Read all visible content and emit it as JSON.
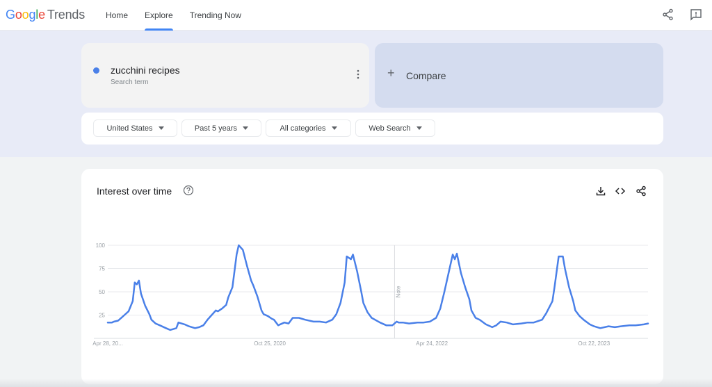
{
  "header": {
    "logo_google": [
      "G",
      "o",
      "o",
      "g",
      "l",
      "e"
    ],
    "logo_product": "Trends",
    "nav": [
      {
        "label": "Home",
        "active": false
      },
      {
        "label": "Explore",
        "active": true
      },
      {
        "label": "Trending Now",
        "active": false
      }
    ],
    "icons": [
      "share-icon",
      "feedback-icon"
    ]
  },
  "search_term": {
    "name": "zucchini recipes",
    "type": "Search term",
    "color": "#4a80e8"
  },
  "compare": {
    "label": "Compare",
    "icon": "plus-icon"
  },
  "filters": [
    {
      "label": "United States"
    },
    {
      "label": "Past 5 years"
    },
    {
      "label": "All categories"
    },
    {
      "label": "Web Search"
    }
  ],
  "card": {
    "title": "Interest over time",
    "icons": [
      "download-icon",
      "embed-icon",
      "share-icon"
    ]
  },
  "chart_data": {
    "type": "line",
    "title": "Interest over time",
    "xlabel": "",
    "ylabel": "",
    "ylim": [
      0,
      100
    ],
    "yticks": [
      25,
      50,
      75,
      100
    ],
    "grid": true,
    "x_range": [
      0,
      260
    ],
    "xtick_labels": [
      {
        "x": 0,
        "label": "Apr 28, 20..."
      },
      {
        "x": 78,
        "label": "Oct 25, 2020"
      },
      {
        "x": 156,
        "label": "Apr 24, 2022"
      },
      {
        "x": 234,
        "label": "Oct 22, 2023"
      }
    ],
    "annotation": {
      "x": 138,
      "label": "Note"
    },
    "series": [
      {
        "name": "zucchini recipes",
        "color": "#4a80e8",
        "points": [
          [
            0,
            17
          ],
          [
            2,
            17
          ],
          [
            3,
            18
          ],
          [
            5,
            19
          ],
          [
            7,
            23
          ],
          [
            8,
            25
          ],
          [
            10,
            29
          ],
          [
            12,
            40
          ],
          [
            13,
            60
          ],
          [
            14,
            58
          ],
          [
            15,
            62
          ],
          [
            16,
            48
          ],
          [
            18,
            35
          ],
          [
            20,
            26
          ],
          [
            21,
            20
          ],
          [
            23,
            16
          ],
          [
            25,
            14
          ],
          [
            28,
            11
          ],
          [
            30,
            9
          ],
          [
            33,
            11
          ],
          [
            34,
            17
          ],
          [
            37,
            15
          ],
          [
            39,
            13
          ],
          [
            42,
            11
          ],
          [
            44,
            12
          ],
          [
            46,
            14
          ],
          [
            48,
            20
          ],
          [
            50,
            25
          ],
          [
            52,
            30
          ],
          [
            53,
            29
          ],
          [
            55,
            32
          ],
          [
            57,
            36
          ],
          [
            58,
            44
          ],
          [
            60,
            55
          ],
          [
            62,
            90
          ],
          [
            63,
            100
          ],
          [
            65,
            95
          ],
          [
            67,
            78
          ],
          [
            69,
            62
          ],
          [
            70,
            57
          ],
          [
            72,
            45
          ],
          [
            74,
            30
          ],
          [
            75,
            26
          ],
          [
            77,
            24
          ],
          [
            79,
            21
          ],
          [
            80,
            20
          ],
          [
            82,
            14
          ],
          [
            85,
            17
          ],
          [
            87,
            16
          ],
          [
            89,
            22
          ],
          [
            92,
            22
          ],
          [
            95,
            20
          ],
          [
            99,
            18
          ],
          [
            102,
            18
          ],
          [
            105,
            17
          ],
          [
            108,
            20
          ],
          [
            110,
            26
          ],
          [
            112,
            38
          ],
          [
            114,
            60
          ],
          [
            115,
            88
          ],
          [
            117,
            85
          ],
          [
            118,
            90
          ],
          [
            120,
            72
          ],
          [
            122,
            50
          ],
          [
            123,
            38
          ],
          [
            125,
            28
          ],
          [
            127,
            22
          ],
          [
            131,
            17
          ],
          [
            134,
            14
          ],
          [
            137,
            14
          ],
          [
            139,
            18
          ],
          [
            140,
            17
          ],
          [
            142,
            17
          ],
          [
            145,
            16
          ],
          [
            149,
            17
          ],
          [
            152,
            17
          ],
          [
            155,
            18
          ],
          [
            158,
            22
          ],
          [
            160,
            32
          ],
          [
            162,
            50
          ],
          [
            164,
            70
          ],
          [
            166,
            90
          ],
          [
            167,
            85
          ],
          [
            168,
            91
          ],
          [
            170,
            70
          ],
          [
            172,
            55
          ],
          [
            174,
            42
          ],
          [
            175,
            30
          ],
          [
            177,
            22
          ],
          [
            179,
            20
          ],
          [
            182,
            15
          ],
          [
            185,
            12
          ],
          [
            187,
            14
          ],
          [
            189,
            18
          ],
          [
            192,
            17
          ],
          [
            195,
            15
          ],
          [
            199,
            16
          ],
          [
            202,
            17
          ],
          [
            205,
            17
          ],
          [
            209,
            20
          ],
          [
            211,
            27
          ],
          [
            214,
            40
          ],
          [
            215,
            55
          ],
          [
            217,
            88
          ],
          [
            219,
            88
          ],
          [
            220,
            75
          ],
          [
            222,
            55
          ],
          [
            224,
            40
          ],
          [
            225,
            30
          ],
          [
            227,
            24
          ],
          [
            229,
            20
          ],
          [
            232,
            15
          ],
          [
            234,
            13
          ],
          [
            237,
            11
          ],
          [
            241,
            13
          ],
          [
            244,
            12
          ],
          [
            247,
            13
          ],
          [
            251,
            14
          ],
          [
            254,
            14
          ],
          [
            258,
            15
          ],
          [
            260,
            16
          ]
        ]
      }
    ]
  }
}
